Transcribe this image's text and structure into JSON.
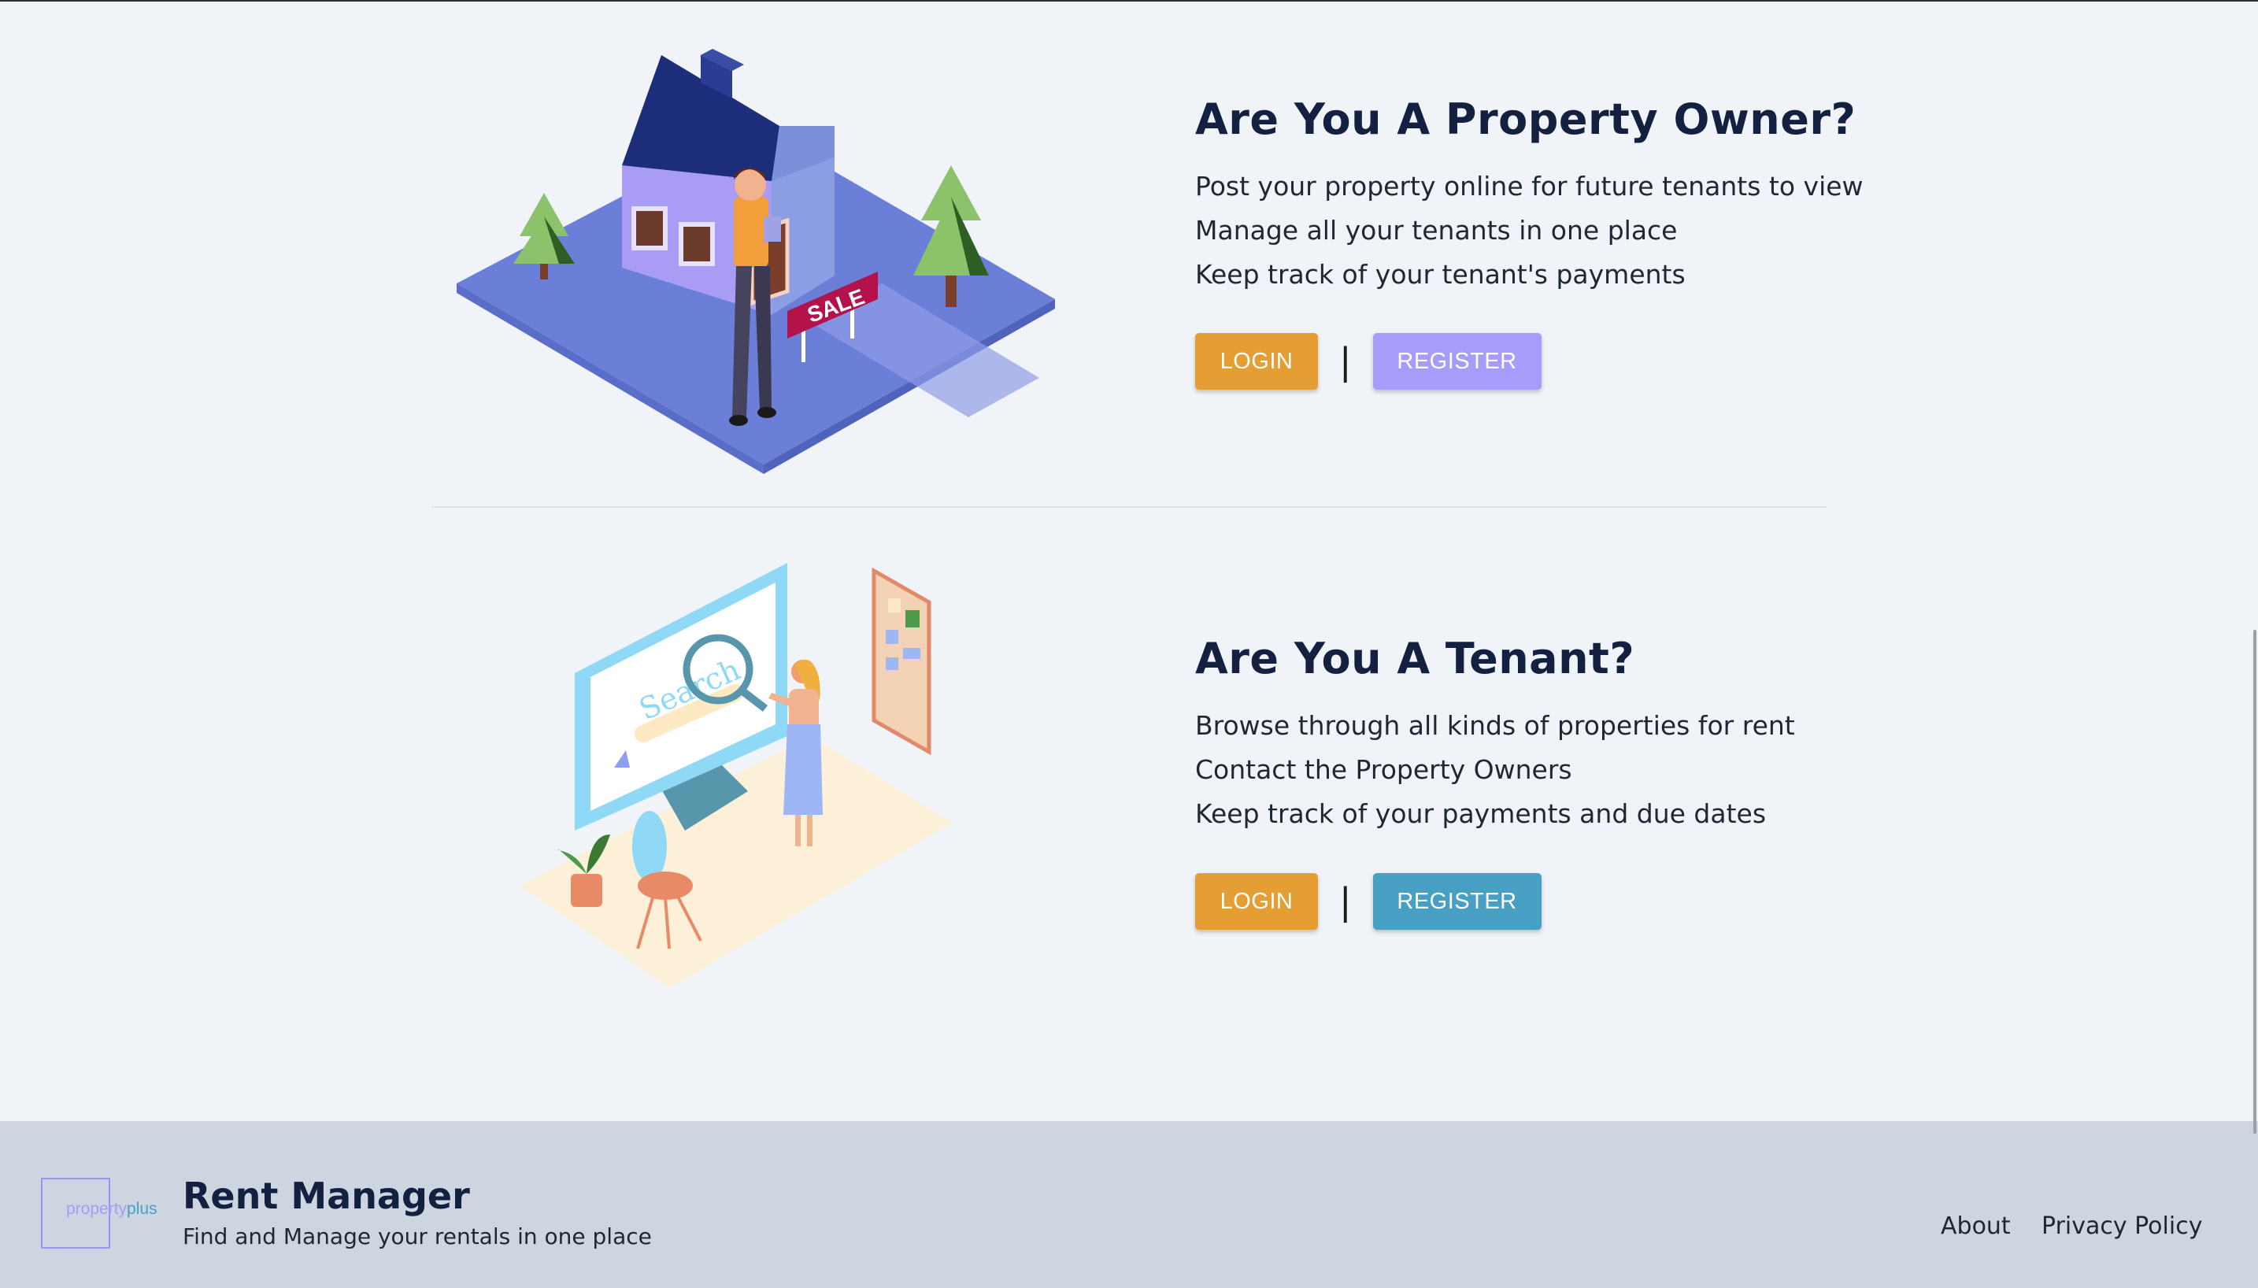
{
  "owner": {
    "heading": "Are You A Property Owner?",
    "lines": [
      "Post your property online for future tenants to view",
      "Manage all your tenants in one place",
      "Keep track of your tenant's payments"
    ],
    "login_label": "LOGIN",
    "separator": "|",
    "register_label": "REGISTER",
    "sale_sign": "SALE",
    "colors": {
      "login": "#e59e33",
      "register": "#a79cf9"
    }
  },
  "tenant": {
    "heading": "Are You A Tenant?",
    "lines": [
      "Browse through all kinds of properties for rent",
      "Contact the Property Owners",
      "Keep track of your payments and due dates"
    ],
    "login_label": "LOGIN",
    "separator": "|",
    "register_label": "REGISTER",
    "search_word": "Search",
    "colors": {
      "login": "#e59e33",
      "register": "#479fc4"
    }
  },
  "footer": {
    "logo_part1": "property",
    "logo_part2": "plus",
    "title": "Rent Manager",
    "subtitle": "Find and Manage your rentals in one place",
    "links": [
      "About",
      "Privacy Policy"
    ]
  }
}
